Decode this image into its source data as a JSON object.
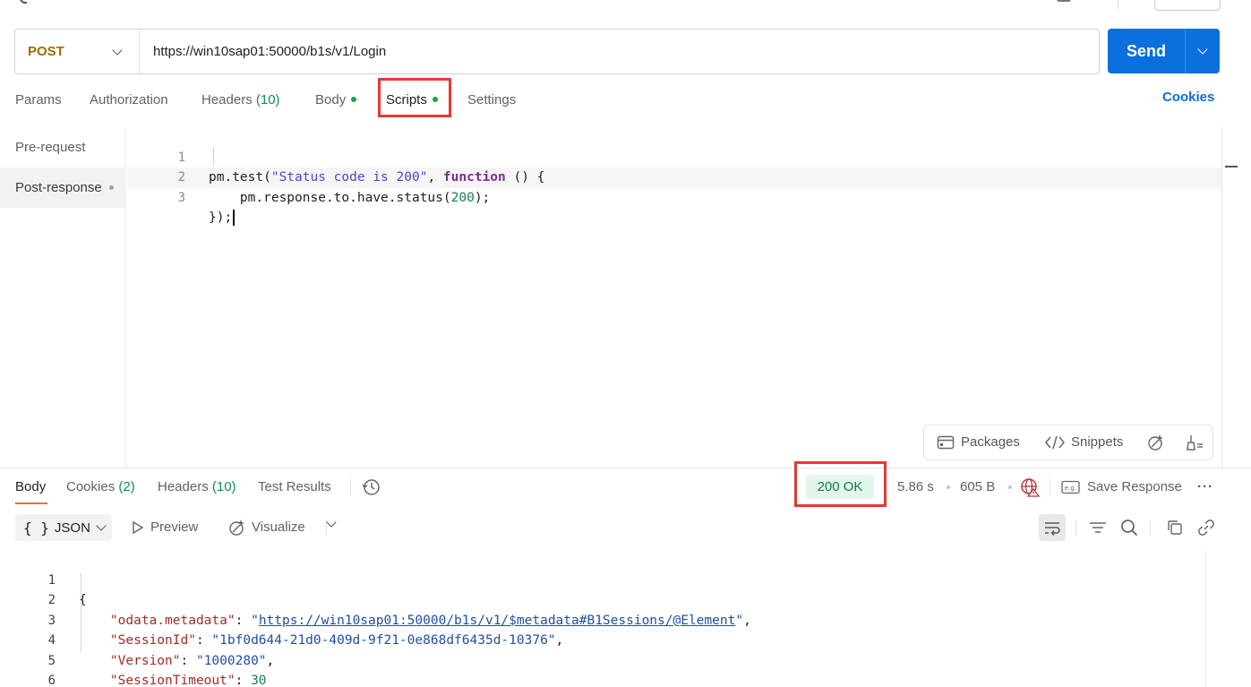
{
  "request": {
    "method": "POST",
    "url": "https://win10sap01:50000/b1s/v1/Login",
    "send_label": "Send"
  },
  "request_tabs": [
    {
      "label": "Params"
    },
    {
      "label": "Authorization"
    },
    {
      "label": "Headers",
      "count": "(10)"
    },
    {
      "label": "Body"
    },
    {
      "label": "Scripts"
    },
    {
      "label": "Settings"
    }
  ],
  "cookies_label": "Cookies",
  "scripts_side": [
    {
      "label": "Pre-request"
    },
    {
      "label": "Post-response"
    }
  ],
  "script_lines": [
    {
      "n": "1"
    },
    {
      "n": "2"
    },
    {
      "n": "3"
    }
  ],
  "script_tokens": {
    "l1_a": "pm.test(",
    "l1_str": "\"Status code is 200\"",
    "l1_b": ", ",
    "l1_kw": "function",
    "l1_c": " () {",
    "l2_a": "    pm.response.to.have.status(",
    "l2_num": "200",
    "l2_b": ");",
    "l3": "});"
  },
  "editor_toolbar": {
    "packages": "Packages",
    "snippets": "Snippets"
  },
  "response_tabs": [
    {
      "label": "Body"
    },
    {
      "label": "Cookies",
      "count": "(2)"
    },
    {
      "label": "Headers",
      "count": "(10)"
    },
    {
      "label": "Test Results"
    }
  ],
  "response_meta": {
    "status": "200 OK",
    "time": "5.86 s",
    "size": "605 B",
    "save_label": "Save Response",
    "more": "···"
  },
  "response_toolbar": {
    "format": "JSON",
    "preview": "Preview",
    "visualize": "Visualize"
  },
  "response_lines": {
    "n1": "1",
    "n2": "2",
    "n3": "3",
    "n4": "4",
    "n5": "5",
    "n6": "6",
    "open": "{",
    "k1": "\"odata.metadata\"",
    "v1": "https://win10sap01:50000/b1s/v1/$metadata#B1Sessions/@Element",
    "k2": "\"SessionId\"",
    "v2": "\"1bf0d644-21d0-409d-9f21-0e868df6435d-10376\"",
    "k3": "\"Version\"",
    "v3": "\"1000280\"",
    "k4": "\"SessionTimeout\"",
    "v4": "30",
    "close": "}"
  },
  "colors": {
    "accent": "#0b6fde",
    "method": "#9a6e00",
    "highlight": "#e53935",
    "status_bg": "#e2f6ea",
    "status_fg": "#137a46",
    "tab_underline": "#f26b3a"
  }
}
